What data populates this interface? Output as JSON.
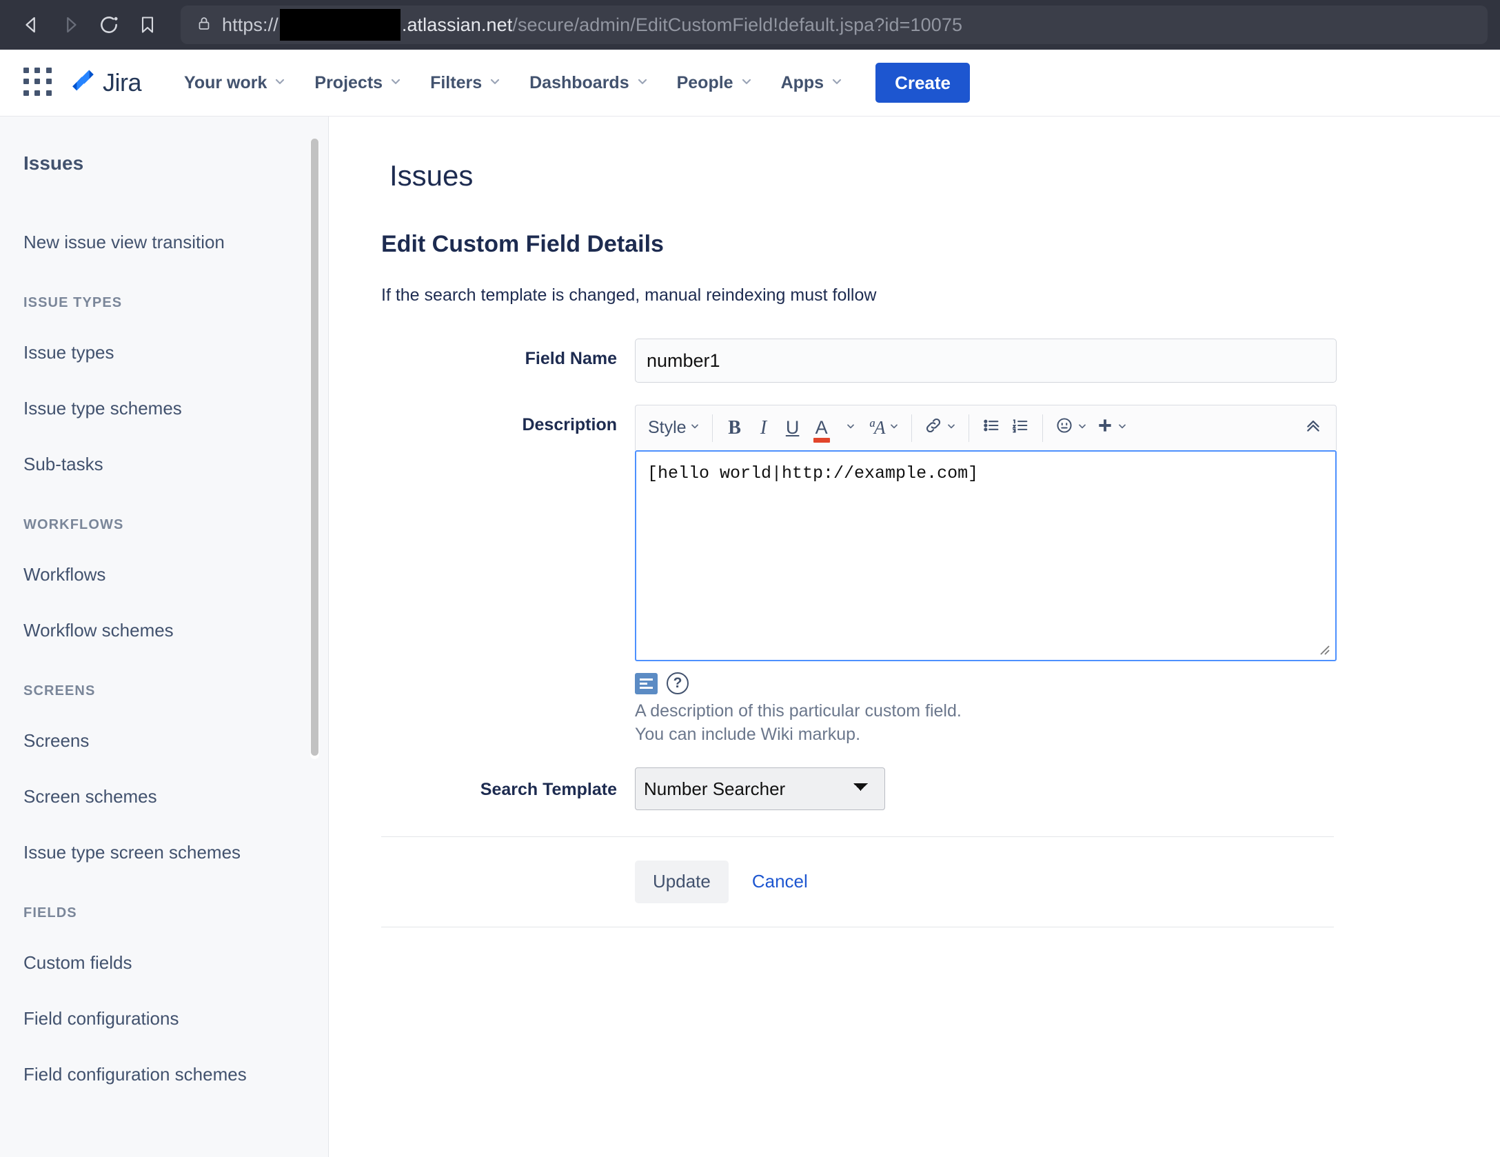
{
  "browser": {
    "back_icon": "back-arrow-icon",
    "forward_icon": "forward-arrow-icon",
    "reload_icon": "reload-icon",
    "bookmark_icon": "bookmark-icon",
    "lock_icon": "lock-icon",
    "url": {
      "scheme": "https://",
      "host_suffix": ".atlassian.net",
      "path": "/secure/admin/EditCustomField!default.jspa?id=10075",
      "full": "https://█████.atlassian.net/secure/admin/EditCustomField!default.jspa?id=10075"
    }
  },
  "topnav": {
    "app_switcher_icon": "app-switcher-grid-icon",
    "product_name": "Jira",
    "items": [
      {
        "label": "Your work",
        "has_chevron": true
      },
      {
        "label": "Projects",
        "has_chevron": true
      },
      {
        "label": "Filters",
        "has_chevron": true
      },
      {
        "label": "Dashboards",
        "has_chevron": true
      },
      {
        "label": "People",
        "has_chevron": true
      },
      {
        "label": "Apps",
        "has_chevron": true
      }
    ],
    "create_label": "Create",
    "create_color": "#1d56d0"
  },
  "sidebar": {
    "title": "Issues",
    "groups": [
      {
        "heading": null,
        "items": [
          {
            "label": "New issue view transition"
          }
        ]
      },
      {
        "heading": "ISSUE TYPES",
        "items": [
          {
            "label": "Issue types"
          },
          {
            "label": "Issue type schemes"
          },
          {
            "label": "Sub-tasks"
          }
        ]
      },
      {
        "heading": "WORKFLOWS",
        "items": [
          {
            "label": "Workflows"
          },
          {
            "label": "Workflow schemes"
          }
        ]
      },
      {
        "heading": "SCREENS",
        "items": [
          {
            "label": "Screens"
          },
          {
            "label": "Screen schemes"
          },
          {
            "label": "Issue type screen schemes"
          }
        ]
      },
      {
        "heading": "FIELDS",
        "items": [
          {
            "label": "Custom fields"
          },
          {
            "label": "Field configurations"
          },
          {
            "label": "Field configuration schemes"
          }
        ]
      }
    ]
  },
  "main": {
    "page_title": "Issues",
    "section_title": "Edit Custom Field Details",
    "hint": "If the search template is changed, manual reindexing must follow",
    "field_name": {
      "label": "Field Name",
      "value": "number1",
      "placeholder": ""
    },
    "description": {
      "label": "Description",
      "value": "[hello world|http://example.com]",
      "placeholder": "",
      "toolbar": {
        "style_label": "Style",
        "bold_label": "B",
        "italic_label": "I",
        "underline_label": "U",
        "text_color_label": "A",
        "text_color_swatch": "#e2452b",
        "more_text_style_label": "ªA",
        "link_icon": "link-icon",
        "bullet_list_icon": "bullet-list-icon",
        "numbered_list_icon": "numbered-list-icon",
        "emoji_icon": "emoji-icon",
        "insert_more_icon": "plus-icon",
        "collapse_icon": "chevron-double-up-icon",
        "chevron": "⌄"
      },
      "preview_icon": "wiki-preview-icon",
      "help_icon": "help-question-icon",
      "help_line_1": "A description of this particular custom field.",
      "help_line_2": "You can include Wiki markup."
    },
    "search_template": {
      "label": "Search Template",
      "selected": "Number Searcher",
      "options": [
        "Number Searcher"
      ]
    },
    "update_label": "Update",
    "cancel_label": "Cancel"
  }
}
